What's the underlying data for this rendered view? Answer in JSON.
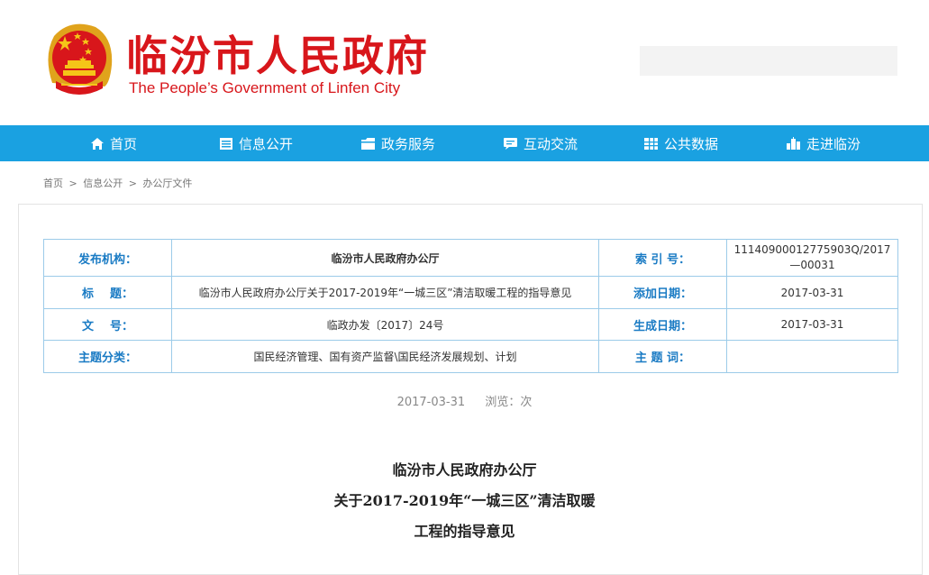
{
  "site": {
    "title": "临汾市人民政府",
    "subtitle": "The People’s Government of Linfen City"
  },
  "nav": [
    {
      "label": "首页",
      "icon": "home-icon"
    },
    {
      "label": "信息公开",
      "icon": "list-icon"
    },
    {
      "label": "政务服务",
      "icon": "folder-icon"
    },
    {
      "label": "互动交流",
      "icon": "chat-icon"
    },
    {
      "label": "公共数据",
      "icon": "grid-icon"
    },
    {
      "label": "走进临汾",
      "icon": "city-icon"
    }
  ],
  "breadcrumb": {
    "items": [
      "首页",
      "信息公开",
      "办公厅文件"
    ],
    "separator": ">"
  },
  "meta": {
    "publisher_label": "发布机构：",
    "publisher": "临汾市人民政府办公厅",
    "index_label": "索 引 号：",
    "index_no": "11140900012775903Q/2017—00031",
    "title_label": "标    题：",
    "title": "临汾市人民政府办公厅关于2017-2019年“一城三区”清洁取暖工程的指导意见",
    "added_label": "添加日期：",
    "added_date": "2017-03-31",
    "docno_label": "文    号：",
    "doc_no": "临政办发〔2017〕24号",
    "generated_label": "生成日期：",
    "generated_date": "2017-03-31",
    "category_label": "主题分类：",
    "category": "国民经济管理、国有资产监督\\国民经济发展规划、计划",
    "keywords_label": "主 题 词：",
    "keywords": ""
  },
  "article": {
    "date": "2017-03-31",
    "views_label": "浏览：次",
    "title_line1": "临汾市人民政府办公厅",
    "title_line2": "关于2017-2019年“一城三区”清洁取暖",
    "title_line3": "工程的指导意见"
  },
  "colors": {
    "brand_red": "#d8161b",
    "nav_blue": "#1aa1e1",
    "label_blue": "#1a7bc4",
    "table_border": "#9ccbe9"
  }
}
